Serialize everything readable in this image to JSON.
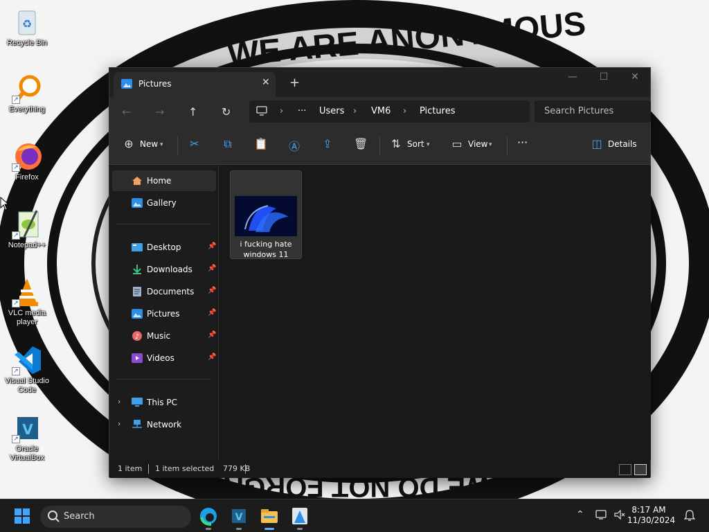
{
  "desktop": {
    "icons": [
      {
        "label": "Recycle Bin",
        "icon": "recycle-bin-icon"
      },
      {
        "label": "Everything",
        "icon": "magnifier-icon"
      },
      {
        "label": "Firefox",
        "icon": "firefox-icon"
      },
      {
        "label": "Notepad++",
        "icon": "notepad-plus-plus-icon"
      },
      {
        "label": "VLC media player",
        "icon": "vlc-cone-icon"
      },
      {
        "label": "Visual Studio Code",
        "icon": "vscode-icon"
      },
      {
        "label": "Oracle VirtualBox",
        "icon": "virtualbox-icon"
      }
    ],
    "wallpaper_text_top": "WE ARE ANONYMOUS",
    "wallpaper_text_bottom": "WE DO NOT FORGIVE"
  },
  "explorer": {
    "tab_title": "Pictures",
    "tab_close": "✕",
    "new_tab": "+",
    "window_controls": {
      "minimize": "—",
      "maximize": "☐",
      "close": "✕"
    },
    "nav": {
      "back": "←",
      "forward": "→",
      "up": "↑",
      "refresh": "↻"
    },
    "breadcrumb": [
      "Users",
      "VM6",
      "Pictures"
    ],
    "breadcrumb_overflow": "···",
    "search_placeholder": "Search Pictures",
    "toolbar": {
      "new_label": "New",
      "sort_label": "Sort",
      "view_label": "View",
      "more_label": "···",
      "details_label": "Details"
    },
    "sidebar": {
      "top": [
        {
          "label": "Home",
          "icon": "home-icon",
          "active": true
        },
        {
          "label": "Gallery",
          "icon": "gallery-icon"
        }
      ],
      "pinned": [
        {
          "label": "Desktop",
          "icon": "desktop-folder-icon"
        },
        {
          "label": "Downloads",
          "icon": "downloads-icon"
        },
        {
          "label": "Documents",
          "icon": "documents-icon"
        },
        {
          "label": "Pictures",
          "icon": "pictures-icon"
        },
        {
          "label": "Music",
          "icon": "music-icon"
        },
        {
          "label": "Videos",
          "icon": "videos-icon"
        }
      ],
      "bottom": [
        {
          "label": "This PC",
          "icon": "this-pc-icon"
        },
        {
          "label": "Network",
          "icon": "network-icon"
        }
      ]
    },
    "files": [
      {
        "name": "i fucking hate windows 11",
        "type": "image"
      }
    ],
    "status": {
      "count": "1 item",
      "selected": "1 item selected",
      "size": "779 KB"
    }
  },
  "taskbar": {
    "search_label": "Search",
    "apps": [
      "edge-icon",
      "vscode-app-icon",
      "file-explorer-icon",
      "snipping-tool-icon"
    ],
    "time": "8:17 AM",
    "date": "11/30/2024",
    "tray": {
      "chevron": "^",
      "notifications": "bell-icon"
    }
  }
}
